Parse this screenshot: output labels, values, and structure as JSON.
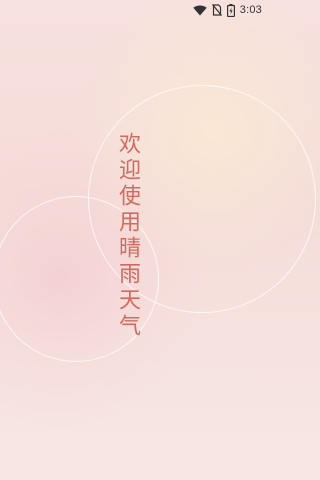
{
  "status_bar": {
    "time": "3:03",
    "icons": [
      "wifi-icon",
      "no-sim-icon",
      "battery-charging-icon"
    ]
  },
  "splash": {
    "welcome_text": "欢迎使用晴雨天气"
  },
  "colors": {
    "text_accent": "#d46a5e",
    "background": "#f6dfdc"
  }
}
